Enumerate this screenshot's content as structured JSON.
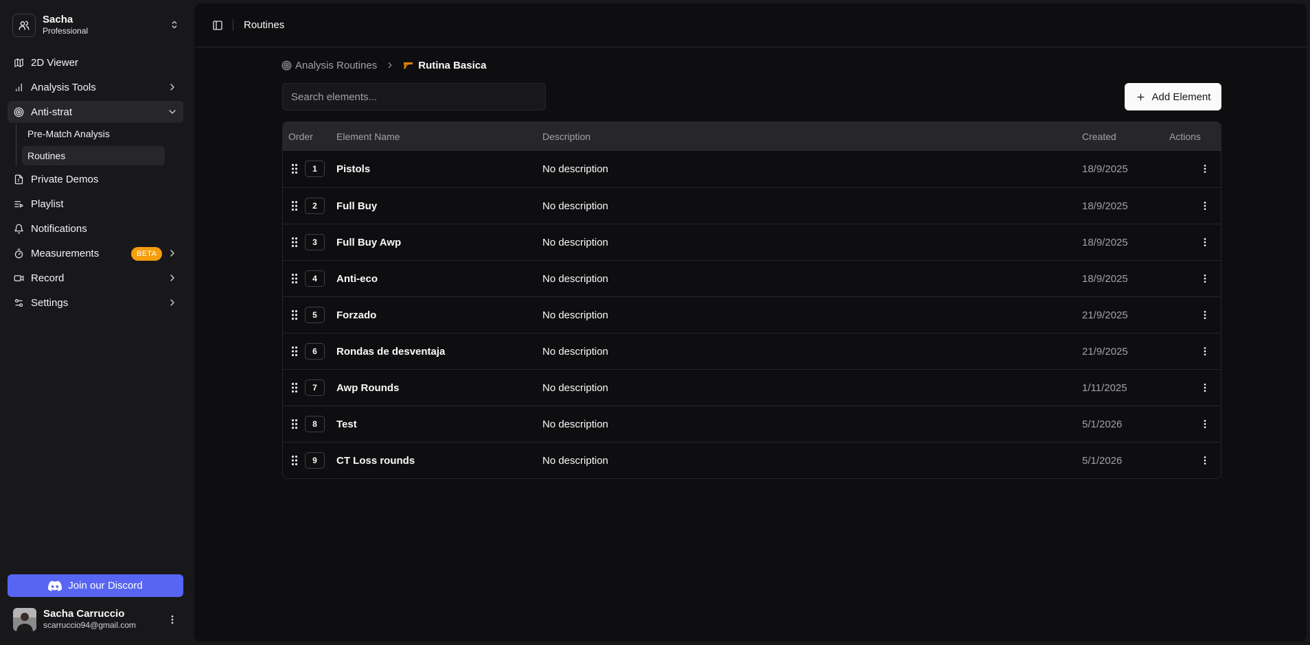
{
  "team": {
    "name": "Sacha",
    "plan": "Professional"
  },
  "nav": {
    "viewer": "2D Viewer",
    "analysis_tools": "Analysis Tools",
    "anti_strat": "Anti-strat",
    "pre_match": "Pre-Match Analysis",
    "routines": "Routines",
    "private_demos": "Private Demos",
    "playlist": "Playlist",
    "notifications": "Notifications",
    "measurements": "Measurements",
    "measurements_badge": "BETA",
    "record": "Record",
    "settings": "Settings"
  },
  "discord_label": "Join our Discord",
  "user": {
    "name": "Sacha Carruccio",
    "email": "scarruccio94@gmail.com"
  },
  "header": {
    "title": "Routines"
  },
  "breadcrumb": {
    "parent": "Analysis Routines",
    "current": "Rutina Basica"
  },
  "search": {
    "placeholder": "Search elements..."
  },
  "add_button": "Add Element",
  "table": {
    "columns": {
      "order": "Order",
      "name": "Element Name",
      "description": "Description",
      "created": "Created",
      "actions": "Actions"
    },
    "rows": [
      {
        "order": "1",
        "name": "Pistols",
        "description": "No description",
        "created": "18/9/2025"
      },
      {
        "order": "2",
        "name": "Full Buy",
        "description": "No description",
        "created": "18/9/2025"
      },
      {
        "order": "3",
        "name": "Full Buy Awp",
        "description": "No description",
        "created": "18/9/2025"
      },
      {
        "order": "4",
        "name": "Anti-eco",
        "description": "No description",
        "created": "18/9/2025"
      },
      {
        "order": "5",
        "name": "Forzado",
        "description": "No description",
        "created": "21/9/2025"
      },
      {
        "order": "6",
        "name": "Rondas de desventaja",
        "description": "No description",
        "created": "21/9/2025"
      },
      {
        "order": "7",
        "name": "Awp Rounds",
        "description": "No description",
        "created": "1/11/2025"
      },
      {
        "order": "8",
        "name": "Test",
        "description": "No description",
        "created": "5/1/2026"
      },
      {
        "order": "9",
        "name": "CT Loss rounds",
        "description": "No description",
        "created": "5/1/2026"
      }
    ]
  },
  "colors": {
    "sidebar_bg": "#18181b",
    "main_bg": "#0e0e10",
    "discord": "#5865f2",
    "beta_badge": "#f59e0b"
  }
}
